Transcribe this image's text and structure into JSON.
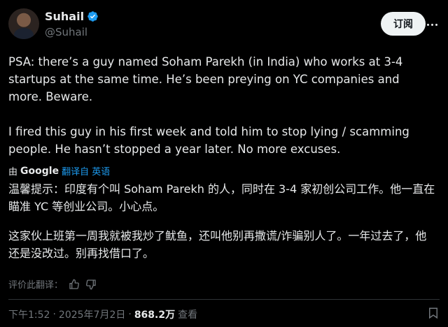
{
  "author": {
    "display_name": "Suhail",
    "handle": "@Suhail"
  },
  "actions": {
    "subscribe_label": "订阅"
  },
  "tweet": {
    "paragraph_1": "PSA: there’s a guy named Soham Parekh (in India) who works at 3-4 startups at the same time. He’s been preying on YC companies and more. Beware.",
    "paragraph_2": "I fired this guy in his first week and told him to stop lying / scamming people. He hasn’t stopped a year later. No more excuses."
  },
  "translation": {
    "prefix": "由",
    "provider": "Google",
    "link_label": "翻译自 英语",
    "paragraph_1": "温馨提示：印度有个叫 Soham Parekh 的人，同时在 3-4 家初创公司工作。他一直在瞄准 YC 等创业公司。小心点。",
    "paragraph_2": "这家伙上班第一周我就被我炒了鱿鱼，还叫他别再撒谎/诈骗别人了。一年过去了，他还是没改过。别再找借口了。",
    "rate_label": "评价此翻译："
  },
  "meta": {
    "time": "下午1:52",
    "sep": "·",
    "date": "2025年7月2日",
    "views_count": "868.2万",
    "views_label": "查看"
  },
  "colors": {
    "background": "#000000",
    "text": "#e7e9ea",
    "muted": "#71767b",
    "accent": "#1d9bf0"
  },
  "icons": [
    "verified-badge-icon",
    "more-icon",
    "thumbs-up-icon",
    "thumbs-down-icon",
    "bookmark-icon"
  ]
}
